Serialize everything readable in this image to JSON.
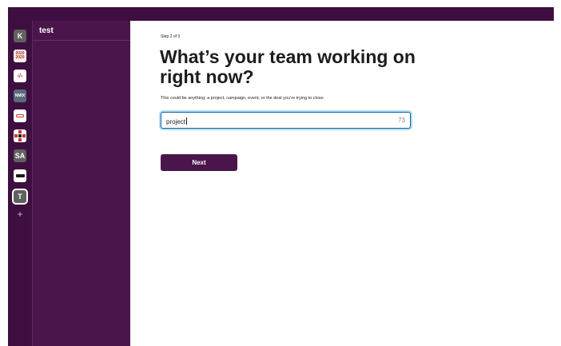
{
  "workspace": {
    "name": "test"
  },
  "rail": {
    "tiles": [
      {
        "label": "K",
        "kind": "letter"
      },
      {
        "label": "2020 2020",
        "kind": "image"
      },
      {
        "label": "",
        "kind": "image"
      },
      {
        "label": "NMIX",
        "kind": "image"
      },
      {
        "label": "",
        "kind": "image"
      },
      {
        "label": "",
        "kind": "image"
      },
      {
        "label": "SA",
        "kind": "letter"
      },
      {
        "label": "",
        "kind": "image"
      },
      {
        "label": "T",
        "kind": "active"
      }
    ],
    "add_symbol": "+"
  },
  "onboarding": {
    "step": "Step 2 of 3",
    "heading": "What’s your team working on right now?",
    "subtext": "This could be anything: a project, campaign, event, or the deal you’re trying to close.",
    "input_value": "project",
    "char_count": "73",
    "next_label": "Next"
  },
  "colors": {
    "aubergine": "#4a154b",
    "aubergine_dark": "#3f0e40",
    "focus_blue": "#1264a3"
  }
}
